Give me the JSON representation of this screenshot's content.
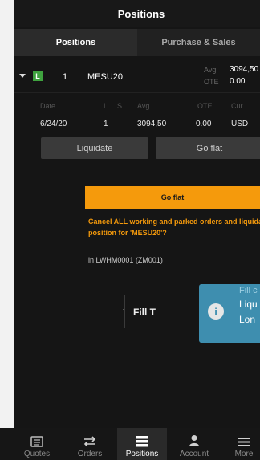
{
  "header": {
    "title": "Positions"
  },
  "tabs": [
    {
      "label": "Positions",
      "active": true
    },
    {
      "label": "Purchase & Sales",
      "active": false
    }
  ],
  "position": {
    "side": "L",
    "quantity": "1",
    "symbol": "MESU20",
    "avg_label": "Avg",
    "ote_label": "OTE",
    "avg_value": "3094,50",
    "ote_value": "0.00"
  },
  "detail": {
    "headers": {
      "date": "Date",
      "l": "L",
      "s": "S",
      "avg": "Avg",
      "ote": "OTE",
      "cur": "Cur"
    },
    "row": {
      "date": "6/24/20",
      "qty": "1",
      "avg": "3094,50",
      "ote": "0.00",
      "cur": "USD"
    },
    "liquidate_label": "Liquidate",
    "goflat_label": "Go flat"
  },
  "dialog": {
    "title": "Go flat",
    "message_line1": "Cancel ALL working and parked orders and liquidate",
    "message_line2": "position for 'MESU20'?",
    "account": "in LWHM0001 (ZM001)"
  },
  "fill_box": {
    "label": "Fill T"
  },
  "toast": {
    "line1": "Fill c",
    "line2": "Liqu",
    "line3": "Lon"
  },
  "bottom_nav": [
    {
      "label": "Quotes",
      "icon": "quotes-icon",
      "active": false
    },
    {
      "label": "Orders",
      "icon": "orders-icon",
      "active": false
    },
    {
      "label": "Positions",
      "icon": "positions-icon",
      "active": true
    },
    {
      "label": "Account",
      "icon": "account-icon",
      "active": false
    },
    {
      "label": "More",
      "icon": "more-icon",
      "active": false
    }
  ],
  "colors": {
    "accent_orange": "#f59a0c",
    "long_green": "#3fa33f",
    "toast_blue": "#3e8eaf",
    "background": "#151515"
  }
}
